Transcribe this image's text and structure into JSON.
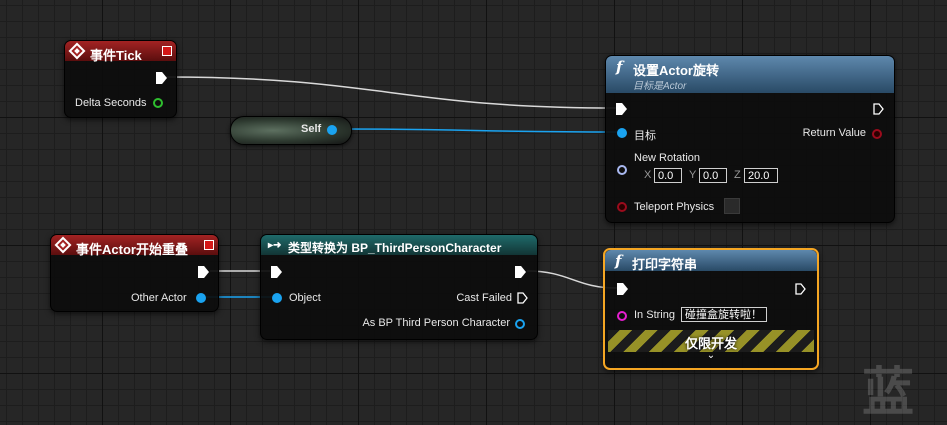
{
  "nodes": {
    "event_tick": {
      "title": "事件Tick",
      "pins": {
        "delta_seconds": "Delta Seconds"
      }
    },
    "self_node": {
      "label": "Self"
    },
    "set_rotation": {
      "title": "设置Actor旋转",
      "subtitle": "目标是Actor",
      "pins": {
        "target": "目标",
        "return_value": "Return Value",
        "new_rotation": "New Rotation",
        "teleport_physics": "Teleport Physics"
      },
      "rotation": {
        "x_label": "X",
        "x_value": "0.0",
        "y_label": "Y",
        "y_value": "0.0",
        "z_label": "Z",
        "z_value": "20.0"
      }
    },
    "event_overlap": {
      "title": "事件Actor开始重叠",
      "pins": {
        "other_actor": "Other Actor"
      }
    },
    "cast": {
      "title": "类型转换为 BP_ThirdPersonCharacter",
      "pins": {
        "object": "Object",
        "cast_failed": "Cast Failed",
        "as_bp": "As BP Third Person Character"
      }
    },
    "print_string": {
      "title": "打印字符串",
      "pins": {
        "in_string": "In String"
      },
      "in_string_value": "碰撞盒旋转啦！",
      "dev_only": "仅限开发"
    }
  },
  "watermark": "蓝",
  "colors": {
    "event_header": "#a32323",
    "cast_header": "#1f6a6a",
    "function_header": "#5e88ad",
    "object_pin": "#1aa3f0",
    "float_pin": "#2fbf2f",
    "string_pin": "#e61ed0",
    "selection_border": "#f5a623"
  },
  "icons": {
    "event": "event-diamond-icon",
    "function": "function-f-icon",
    "cast": "cast-arrows-icon",
    "expand": "chevron-down-icon"
  }
}
